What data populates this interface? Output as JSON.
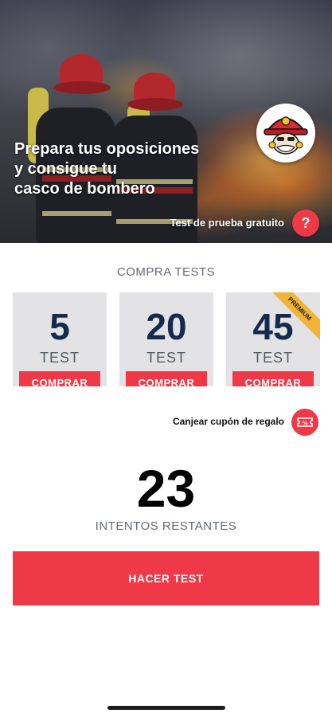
{
  "hero": {
    "title_line1": "Prepara tus oposiciones",
    "title_line2": "y consigue tu",
    "title_line3": "casco de bombero",
    "free_test_label": "Test de prueba gratuito",
    "help_icon": "question-mark-icon",
    "help_glyph": "?"
  },
  "purchase": {
    "section_title": "COMPRA TESTS",
    "packs": [
      {
        "count": "5",
        "unit": "TEST",
        "buy_label": "COMPRAR"
      },
      {
        "count": "20",
        "unit": "TEST",
        "buy_label": "COMPRAR"
      },
      {
        "count": "45",
        "unit": "TEST",
        "buy_label": "COMPRAR",
        "badge": "PREMIUM"
      }
    ],
    "coupon_label": "Canjear cupón de regalo",
    "coupon_icon": "discount-ticket-icon",
    "coupon_glyph": "%"
  },
  "attempts": {
    "count": "23",
    "label": "INTENTOS RESTANTES"
  },
  "cta": {
    "label": "HACER TEST"
  },
  "colors": {
    "accent": "#ef3946",
    "pack_bg": "#e3e3e5",
    "pack_number": "#162a4d",
    "premium_badge": "#f2b233"
  }
}
